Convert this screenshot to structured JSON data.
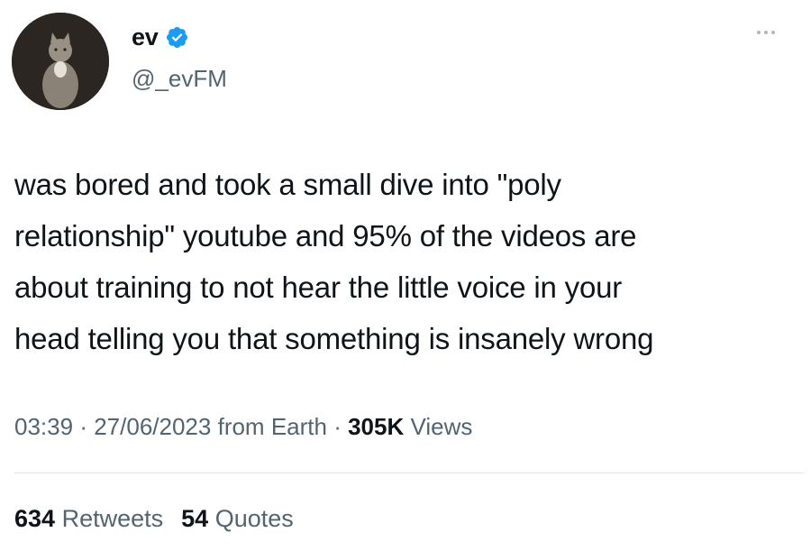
{
  "author": {
    "display_name": "ev",
    "handle": "@_evFM",
    "verified": true,
    "avatar_icon": "cat-avatar-icon"
  },
  "tweet": {
    "text": "was bored and took a small dive into \"poly\nrelationship\" youtube and 95% of the videos are\nabout training to not hear the little voice in your\nhead telling you that something is insanely wrong"
  },
  "meta": {
    "time": "03:39",
    "separator": "·",
    "date": "27/06/2023",
    "source": "from Earth",
    "views_count": "305K",
    "views_label": "Views"
  },
  "stats": {
    "retweets_count": "634",
    "retweets_label": "Retweets",
    "quotes_count": "54",
    "quotes_label": "Quotes"
  },
  "colors": {
    "text_primary": "#0f1419",
    "text_secondary": "#536471",
    "verified_blue": "#1d9bf0",
    "divider": "#e3e6e8"
  }
}
